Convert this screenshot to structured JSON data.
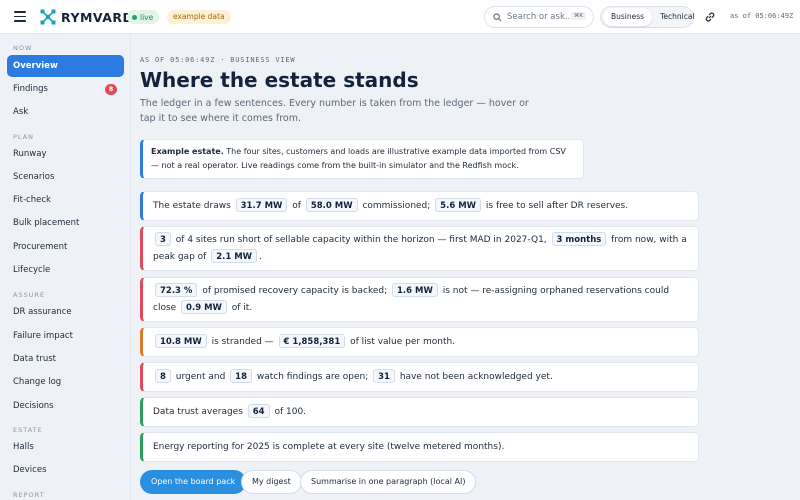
{
  "app": {
    "brand": "RYMVARD",
    "live_label": "live",
    "example_label": "example data"
  },
  "search": {
    "placeholder": "Search or ask...",
    "shortcut": "⌘K"
  },
  "view_toggle": {
    "options": [
      "Business",
      "Technical"
    ],
    "selected": "Business"
  },
  "topbar": {
    "asof": "as of 05:06:49Z"
  },
  "sidebar": {
    "sections": [
      {
        "label": "NOW",
        "items": [
          {
            "label": "Overview",
            "active": true
          },
          {
            "label": "Findings",
            "badge": "8"
          },
          {
            "label": "Ask"
          }
        ]
      },
      {
        "label": "PLAN",
        "items": [
          {
            "label": "Runway"
          },
          {
            "label": "Scenarios"
          },
          {
            "label": "Fit-check"
          },
          {
            "label": "Bulk placement"
          },
          {
            "label": "Procurement"
          },
          {
            "label": "Lifecycle"
          }
        ]
      },
      {
        "label": "ASSURE",
        "items": [
          {
            "label": "DR assurance"
          },
          {
            "label": "Failure impact"
          },
          {
            "label": "Data trust"
          },
          {
            "label": "Change log"
          },
          {
            "label": "Decisions"
          }
        ]
      },
      {
        "label": "ESTATE",
        "items": [
          {
            "label": "Halls"
          },
          {
            "label": "Devices"
          }
        ]
      },
      {
        "label": "REPORT",
        "items": []
      }
    ]
  },
  "main": {
    "eyebrow": "AS OF 05:06:49Z · BUSINESS VIEW",
    "title": "Where the estate stands",
    "lede": "The ledger in a few sentences. Every number is taken from the ledger — hover or tap it to see where it comes from.",
    "callout": {
      "bold": "Example estate.",
      "text": " The four sites, customers and loads are illustrative example data imported from CSV — not a real operator. Live readings come from the built-in simulator and the Redfish mock."
    },
    "cards": [
      {
        "accent": "#2b7be0",
        "parts": [
          {
            "t": "The estate draws "
          },
          {
            "c": "31.7 MW"
          },
          {
            "t": " of "
          },
          {
            "c": "58.0 MW"
          },
          {
            "t": " commissioned; "
          },
          {
            "c": "5.6 MW"
          },
          {
            "t": " is free to sell after DR reserves."
          }
        ]
      },
      {
        "accent": "#e14a56",
        "parts": [
          {
            "c": "3"
          },
          {
            "t": " of 4 sites run short of sellable capacity within the horizon — first MAD in 2027-Q1, "
          },
          {
            "c": "3 months"
          },
          {
            "t": " from now, with a peak gap of "
          },
          {
            "c": "2.1 MW"
          },
          {
            "t": "."
          }
        ]
      },
      {
        "accent": "#e14a56",
        "parts": [
          {
            "c": "72.3 %"
          },
          {
            "t": " of promised recovery capacity is backed; "
          },
          {
            "c": "1.6 MW"
          },
          {
            "t": " is not — re-assigning orphaned reservations could close "
          },
          {
            "c": "0.9 MW"
          },
          {
            "t": " of it."
          }
        ]
      },
      {
        "accent": "#e07a2b",
        "parts": [
          {
            "c": "10.8 MW"
          },
          {
            "t": " is stranded — "
          },
          {
            "c": "€ 1,858,381"
          },
          {
            "t": " of list value per month."
          }
        ]
      },
      {
        "accent": "#e14a56",
        "parts": [
          {
            "c": "8"
          },
          {
            "t": " urgent and "
          },
          {
            "c": "18"
          },
          {
            "t": " watch findings are open; "
          },
          {
            "c": "31"
          },
          {
            "t": " have not been acknowledged yet."
          }
        ]
      },
      {
        "accent": "#2aa05a",
        "parts": [
          {
            "t": "Data trust averages "
          },
          {
            "c": "64"
          },
          {
            "t": " of 100."
          }
        ]
      },
      {
        "accent": "#2aa05a",
        "parts": [
          {
            "t": "Energy reporting for 2025 is complete at every site (twelve metered months)."
          }
        ]
      }
    ],
    "actions": {
      "board_pack": "Open the board pack",
      "digest": "My digest",
      "summarise": "Summarise in one paragraph (local AI)"
    }
  }
}
